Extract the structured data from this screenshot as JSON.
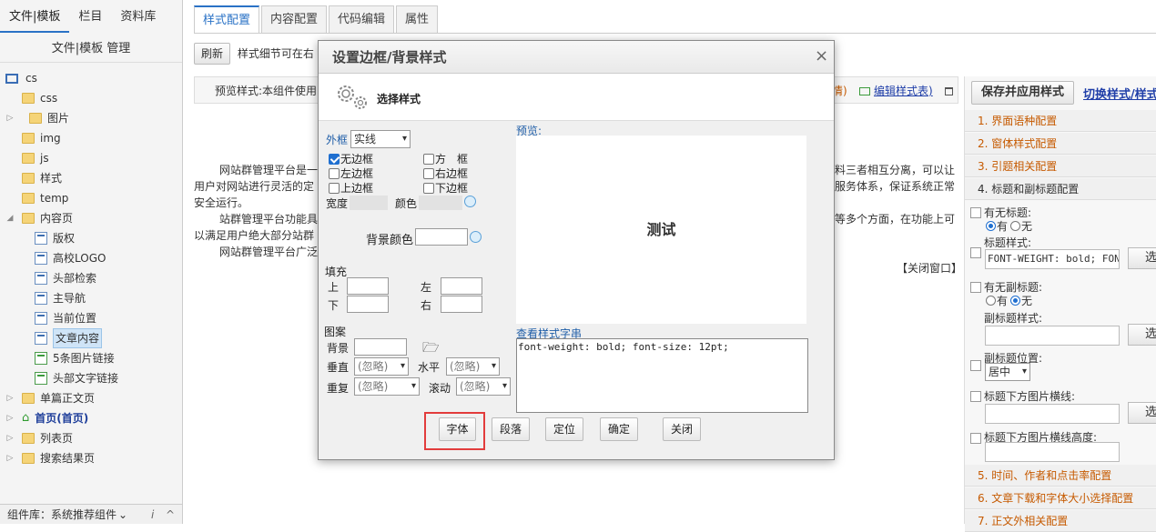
{
  "left_tabs": [
    "文件|模板",
    "栏目",
    "资料库"
  ],
  "left_title": "文件|模板 管理",
  "tree": [
    {
      "label": "cs",
      "type": "root"
    },
    {
      "label": "css",
      "type": "folder"
    },
    {
      "label": "图片",
      "type": "folder"
    },
    {
      "label": "img",
      "type": "folder"
    },
    {
      "label": "js",
      "type": "folder"
    },
    {
      "label": "样式",
      "type": "folder"
    },
    {
      "label": "temp",
      "type": "folder"
    },
    {
      "label": "内容页",
      "type": "folder"
    },
    {
      "label": "版权",
      "type": "page"
    },
    {
      "label": "高校LOGO",
      "type": "page"
    },
    {
      "label": "头部检索",
      "type": "page"
    },
    {
      "label": "主导航",
      "type": "page"
    },
    {
      "label": "当前位置",
      "type": "page"
    },
    {
      "label": "文章内容",
      "type": "page"
    },
    {
      "label": "5条图片链接",
      "type": "page"
    },
    {
      "label": "头部文字链接",
      "type": "page"
    },
    {
      "label": "单篇正文页",
      "type": "folder"
    },
    {
      "label": "首页(首页)",
      "type": "home"
    },
    {
      "label": "列表页",
      "type": "folder"
    },
    {
      "label": "搜索结果页",
      "type": "folder"
    }
  ],
  "left_footer": "组件库：系统推荐组件",
  "main_tabs": [
    "样式配置",
    "内容配置",
    "代码编辑",
    "属性"
  ],
  "toolbar": {
    "refresh": "刷新",
    "hint": "样式细节可在右"
  },
  "preview_label": "预览样式:本组件使用",
  "preview_links": {
    "detail": "情)",
    "edit": "编辑样式表)"
  },
  "content": {
    "p1a": "网站群管理平台是一",
    "p1b": "用户对网站进行灵活的定",
    "p1c": "安全运行。",
    "p1r1": "料三者相互分离，可以让",
    "p1r2": "服务体系，保证系统正常",
    "p2a": "站群管理平台功能具",
    "p2b": "以满足用户绝大部分站群",
    "p2r": "等多个方面，在功能上可",
    "p3": "网站群管理平台广泛",
    "close_window": "【关闭窗口】"
  },
  "right": {
    "save_btn": "保存并应用样式",
    "switch_link": "切换样式/样式",
    "sections": [
      "1. 界面语种配置",
      "2. 窗体样式配置",
      "3. 引题相关配置",
      "4. 标题和副标题配置",
      "5. 时间、作者和点击率配置",
      "6. 文章下载和字体大小选择配置",
      "7. 正文外相关配置"
    ],
    "has_title_label": "有无标题:",
    "yes": "有",
    "no": "无",
    "title_style_label": "标题样式:",
    "title_style_value": "FONT-WEIGHT: bold; FONT-",
    "choose": "选择",
    "has_subtitle_label": "有无副标题:",
    "subtitle_style_label": "副标题样式:",
    "subtitle_pos_label": "副标题位置:",
    "subtitle_pos_value": "居中",
    "img_line_label": "标题下方图片横线:",
    "img_line_height_label": "标题下方图片横线高度:"
  },
  "dialog": {
    "title": "设置边框/背景样式",
    "close": "×",
    "subtitle": "选择样式",
    "border_label": "外框",
    "border_value": "实线",
    "checks": {
      "none": "无边框",
      "left": "左边框",
      "top": "上边框",
      "box": "方　框",
      "right": "右边框",
      "bottom": "下边框"
    },
    "width_label": "宽度",
    "color_label": "颜色",
    "bg_color_label": "背景颜色",
    "padding_label": "填充",
    "pad_top": "上",
    "pad_left": "左",
    "pad_bottom": "下",
    "pad_right": "右",
    "pattern_label": "图案",
    "bg_label": "背景",
    "vertical_label": "垂直",
    "horizontal_label": "水平",
    "repeat_label": "重复",
    "scroll_label": "滚动",
    "ignore": "(忽略)",
    "preview_label": "预览:",
    "preview_text": "测试",
    "css_label": "查看样式字串",
    "css_value": "font-weight: bold; font-size: 12pt;",
    "buttons": {
      "font": "字体",
      "paragraph": "段落",
      "position": "定位",
      "ok": "确定",
      "close": "关闭"
    }
  },
  "colors": {
    "accent": "#2a72c6",
    "highlight": "#e23c3c",
    "section_orange": "#c65a00"
  }
}
